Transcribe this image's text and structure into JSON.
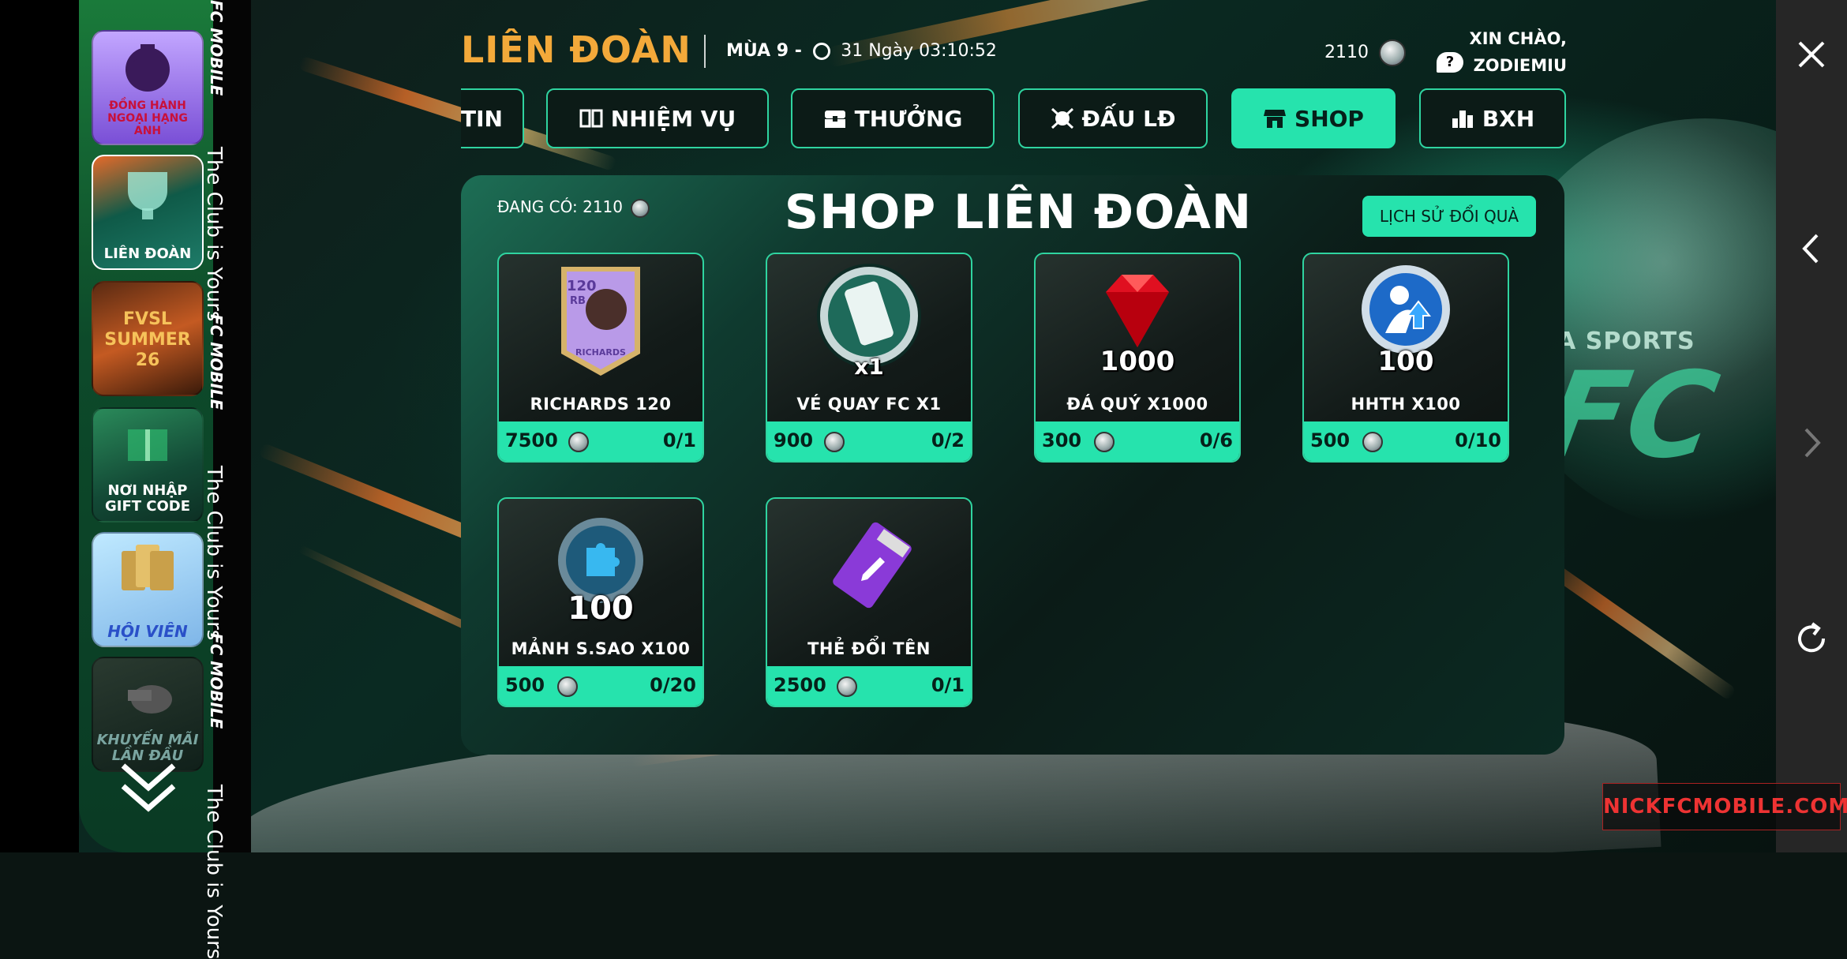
{
  "sidebar": {
    "items": [
      {
        "label": "ĐỒNG HÀNH NGOẠI HẠNG ANH"
      },
      {
        "label": "LIÊN ĐOÀN"
      },
      {
        "label": "FVSL SUMMER 26"
      },
      {
        "label": "NƠI NHẬP GIFT CODE"
      },
      {
        "label": "HỘI VIÊN"
      },
      {
        "label": "KHUYẾN MÃI LẦN ĐẦU"
      }
    ],
    "strip_text": [
      "FC MOBILE",
      "The Club is Yours",
      "FC MOBILE",
      "The Club is Yours",
      "FC MOBILE",
      "The Club is Yours"
    ]
  },
  "header": {
    "title": "LIÊN ĐOÀN",
    "season_label": "MÙA 9 -",
    "time_left": "31 Ngày 03:10:52",
    "coins": "2110",
    "greeting_line1": "XIN CHÀO,",
    "greeting_line2": "ZODIEMIU",
    "help": "?"
  },
  "tabs": [
    {
      "label": "TIN",
      "icon": "info-icon",
      "active": false
    },
    {
      "label": "NHIỆM VỤ",
      "icon": "book-icon",
      "active": false
    },
    {
      "label": "THƯỞNG",
      "icon": "chest-icon",
      "active": false
    },
    {
      "label": "ĐẤU LĐ",
      "icon": "versus-icon",
      "active": false
    },
    {
      "label": "SHOP",
      "icon": "shop-icon",
      "active": true
    },
    {
      "label": "BXH",
      "icon": "ranking-icon",
      "active": false
    }
  ],
  "shop": {
    "title": "SHOP LIÊN ĐOÀN",
    "owned_label": "ĐANG CÓ: 2110",
    "history_button": "LỊCH SỬ ĐỔI QUÀ",
    "items": [
      {
        "name": "RICHARDS 120",
        "price": "7500",
        "limit": "0/1",
        "icon": "player-card-icon",
        "card_ovr": "120",
        "card_pos": "RB",
        "card_name": "RICHARDS"
      },
      {
        "name": "VÉ QUAY FC X1",
        "price": "900",
        "limit": "0/2",
        "icon": "spin-ticket-icon",
        "qty": "x1"
      },
      {
        "name": "ĐÁ QUÝ X1000",
        "price": "300",
        "limit": "0/6",
        "icon": "ruby-gem-icon",
        "qty": "1000"
      },
      {
        "name": "HHTH X100",
        "price": "500",
        "limit": "0/10",
        "icon": "training-upgrade-icon",
        "qty": "100"
      },
      {
        "name": "MẢNH S.SAO X100",
        "price": "500",
        "limit": "0/20",
        "icon": "star-fragment-icon",
        "qty": "100"
      },
      {
        "name": "THẺ ĐỔI TÊN",
        "price": "2500",
        "limit": "0/1",
        "icon": "rename-card-icon"
      }
    ]
  },
  "background": {
    "brand_text": "FA SPORTS",
    "brand_big": "FC",
    "watermark": "NICKFCMOBILE.COM"
  },
  "colors": {
    "accent": "#26e3ad",
    "title_orange": "#f3a93a",
    "panel_dark": "#0b1b17"
  }
}
